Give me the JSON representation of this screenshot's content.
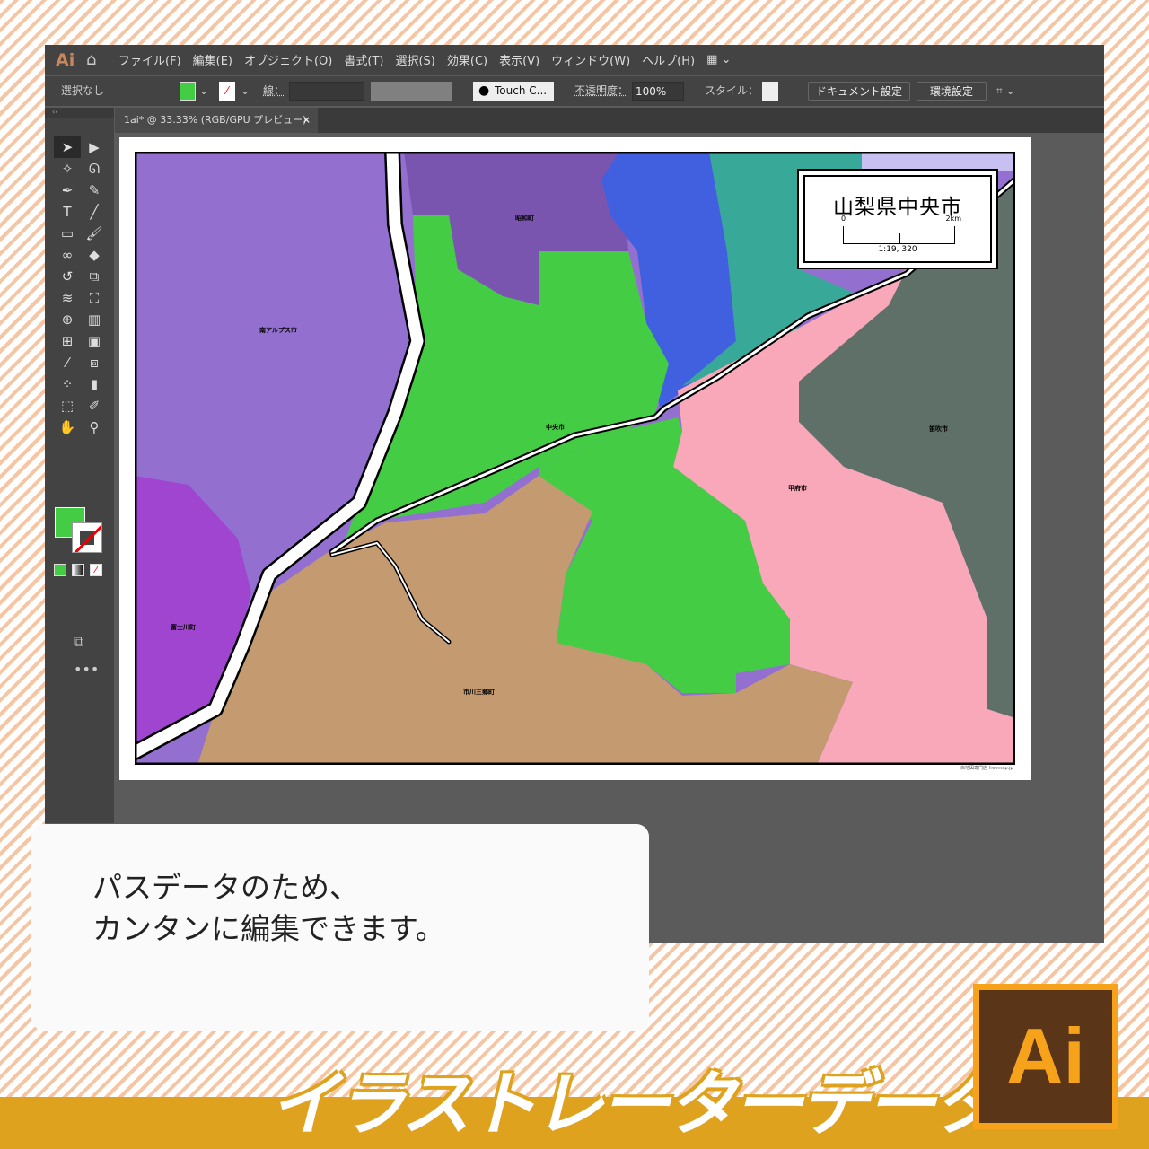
{
  "menu": {
    "logo": "Ai",
    "items": [
      "ファイル(F)",
      "編集(E)",
      "オブジェクト(O)",
      "書式(T)",
      "選択(S)",
      "効果(C)",
      "表示(V)",
      "ウィンドウ(W)",
      "ヘルプ(H)"
    ]
  },
  "control": {
    "selection": "選択なし",
    "stroke_label": "線：",
    "brush": "Touch C...",
    "opacity_label": "不透明度：",
    "opacity": "100%",
    "style_label": "スタイル：",
    "doc_settings": "ドキュメント設定",
    "preferences": "環境設定"
  },
  "tab": {
    "title": "1ai* @ 33.33% (RGB/GPU プレビュー)",
    "close": "×"
  },
  "colors": {
    "fill": "#44cc44",
    "accent": "#dfa21e"
  },
  "map": {
    "title": "山梨県中央市",
    "scale_start": "0",
    "scale_end": "2km",
    "ratio": "1:19, 320",
    "labels": [
      "昭和町",
      "南アルプス市",
      "中央市",
      "笛吹市",
      "甲府市",
      "富士川町",
      "市川三郷町"
    ],
    "credit": "白地図専門店 freemap.jp"
  },
  "note": {
    "line1": "パスデータのため、",
    "line2": "カンタンに編集できます。"
  },
  "banner": "イラストレーターデータ",
  "ai_logo": "Ai"
}
